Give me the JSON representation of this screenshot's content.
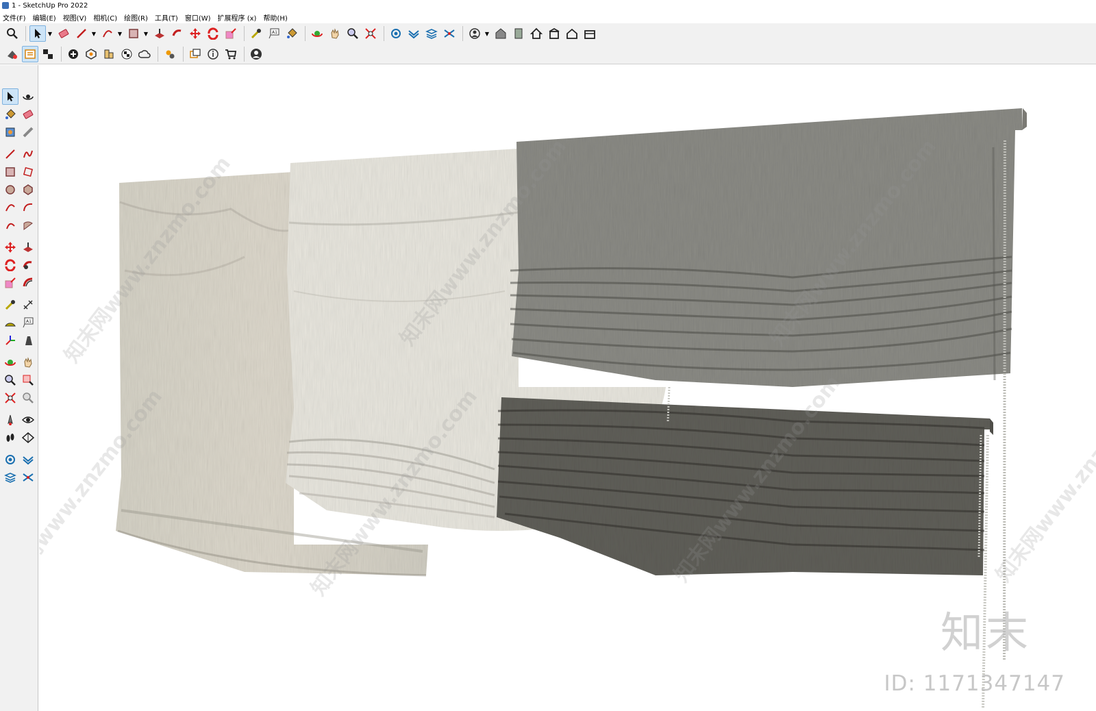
{
  "window": {
    "title": "1 - SketchUp Pro 2022"
  },
  "menu": {
    "items": [
      "文件(F)",
      "编辑(E)",
      "视图(V)",
      "相机(C)",
      "绘图(R)",
      "工具(T)",
      "窗口(W)",
      "扩展程序 (x)",
      "帮助(H)"
    ]
  },
  "toolbar1": {
    "icons": [
      "zoom-icon",
      "select-arrow-icon",
      "eraser-icon",
      "pencil-line-icon",
      "arc-icon",
      "rectangle-icon",
      "push-pull-icon",
      "follow-me-icon",
      "move-icon",
      "rotate-icon",
      "scale-icon",
      "tape-measure-icon",
      "text-icon",
      "paint-bucket-icon",
      "orbit-icon",
      "pan-icon",
      "zoom-tool-icon",
      "zoom-extents-icon",
      "sandbox-icon",
      "layer-icon",
      "tags-icon",
      "section-icon",
      "user-icon",
      "warehouse-icon",
      "component-icon",
      "house-icon",
      "house-front-icon",
      "house-outline-icon",
      "box-icon"
    ]
  },
  "toolbar2": {
    "icons": [
      "model-info-icon",
      "outliner-icon",
      "components-icon",
      "add-location-icon",
      "shadow-icon",
      "geo-location-icon",
      "checker-icon",
      "cloud-icon",
      "extension-gear-icon",
      "scenes-icon",
      "info-icon",
      "cart-icon",
      "account-icon"
    ]
  },
  "palette": {
    "rows": [
      [
        "select-icon",
        "orbit-icon"
      ],
      [
        "paint-icon",
        "eraser-icon"
      ],
      [
        "component-icon",
        "tape-icon"
      ],
      [
        "line-icon",
        "freehand-icon"
      ],
      [
        "rectangle-icon",
        "rotated-rect-icon"
      ],
      [
        "circle-icon",
        "polygon-icon"
      ],
      [
        "arc-icon",
        "arc-2-icon"
      ],
      [
        "pie-icon",
        "three-point-arc-icon"
      ],
      [
        "move-icon",
        "push-pull-icon"
      ],
      [
        "rotate-icon",
        "follow-me-icon"
      ],
      [
        "scale-icon",
        "offset-icon"
      ],
      [
        "tape-measure-icon",
        "dimension-icon"
      ],
      [
        "protractor-icon",
        "text-icon"
      ],
      [
        "axes-icon",
        "3d-text-icon"
      ],
      [
        "orbit-2-icon",
        "pan-icon"
      ],
      [
        "zoom-icon",
        "zoom-window-icon"
      ],
      [
        "zoom-extents-icon",
        "previous-icon"
      ],
      [
        "position-camera-icon",
        "look-around-icon"
      ],
      [
        "walk-icon",
        "section-plane-icon"
      ],
      [
        "sandbox-icon",
        "stamp-icon"
      ],
      [
        "drape-icon",
        "smoove-icon"
      ]
    ]
  },
  "watermarks": {
    "diag_text": "知末网www.znzmo.com",
    "brand": "知末",
    "id": "ID: 1171347147"
  },
  "colors": {
    "accent": "#cde4f7",
    "toolbar_bg": "#f1f1f1",
    "blind_beige": "#d8d5ca",
    "blind_white": "#e9e7df",
    "blind_gray": "#8a8a84",
    "blind_dark": "#5f5e58"
  }
}
